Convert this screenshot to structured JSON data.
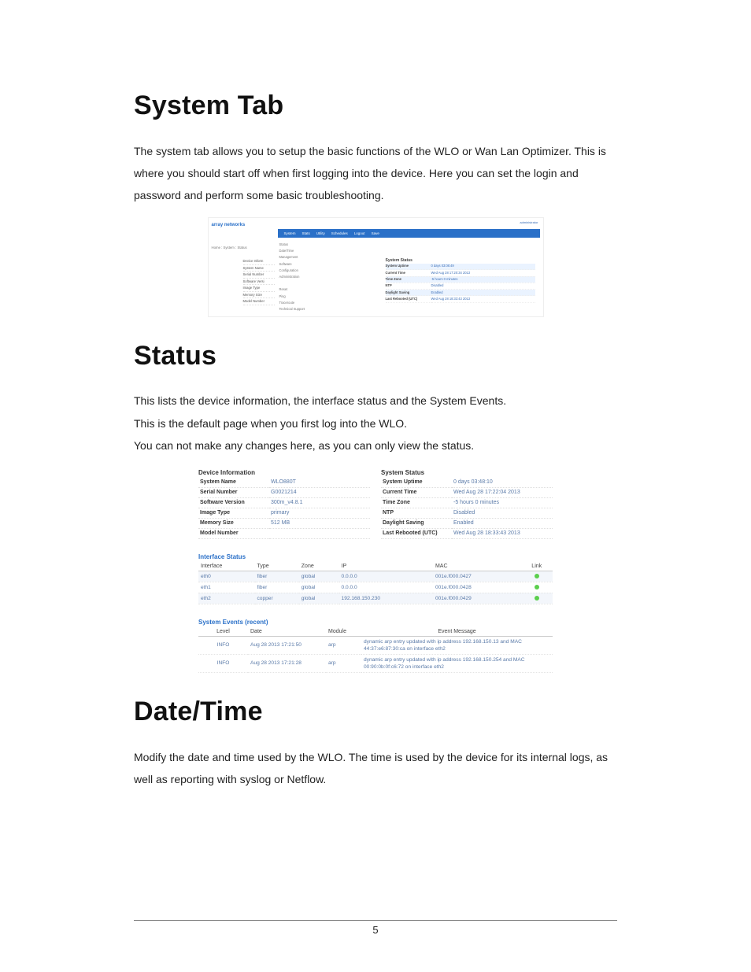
{
  "h1_systemtab": "System Tab",
  "p_systemtab": "The system tab allows you to setup the basic functions of the WLO or Wan Lan Optimizer. This is where you should start off when first logging into the device. Here you can set the login and password and perform some basic troubleshooting.",
  "h1_status": "Status",
  "p_status_1": "This lists the device information, the interface status and the System Events.",
  "p_status_2": "This is the default page when you first log into the WLO.",
  "p_status_3": "You can not make any changes here, as you can only view the status.",
  "h1_datetime": "Date/Time",
  "p_datetime": "Modify the date and time used by the WLO. The time is used by the device for its internal logs, as well as reporting with syslog or Netflow.",
  "page_number": "5",
  "shot1": {
    "logo": "array networks",
    "admin_label": "administrator",
    "topnav": [
      "System",
      "Stats",
      "Utility",
      "Schedules",
      "Logout",
      "Save"
    ],
    "crumb": "Home : System : Status",
    "side_labels": [
      "Device Inform",
      "System Name",
      "Serial Number",
      "Software Versi",
      "Image Type",
      "Memory Size",
      "Model Number"
    ],
    "menu_items": [
      "Status",
      "Date/Time",
      "Management",
      "Software",
      "Configuration",
      "Administration",
      "",
      "Reset",
      "Ping",
      "Traceroute",
      "Technical Support"
    ],
    "panel_title": "System Status",
    "rows": [
      {
        "k": "System Uptime",
        "v": "0 days 03:08:49",
        "hl": true
      },
      {
        "k": "Current Time",
        "v": "Wed Aug 28 17:20:34 2013"
      },
      {
        "k": "Time Zone",
        "v": "-5 hours 0 minutes",
        "hl": true
      },
      {
        "k": "NTP",
        "v": "Disabled"
      },
      {
        "k": "Daylight Saving",
        "v": "Enabled",
        "hl": true
      },
      {
        "k": "Last Rebooted (UTC)",
        "v": "Wed Aug 28 18:33:43 2013"
      }
    ]
  },
  "shot2": {
    "dev_title": "Device Information",
    "dev_rows": [
      {
        "k": "System Name",
        "v": "WLO880T"
      },
      {
        "k": "Serial Number",
        "v": "G0021214"
      },
      {
        "k": "Software Version",
        "v": "300m_v4.8.1"
      },
      {
        "k": "Image Type",
        "v": "primary"
      },
      {
        "k": "Memory Size",
        "v": "512 MB"
      },
      {
        "k": "Model Number",
        "v": ""
      }
    ],
    "sys_title": "System Status",
    "sys_rows": [
      {
        "k": "System Uptime",
        "v": "0 days 03:48:10"
      },
      {
        "k": "Current Time",
        "v": "Wed Aug 28 17:22:04 2013"
      },
      {
        "k": "Time Zone",
        "v": "-5 hours 0 minutes"
      },
      {
        "k": "NTP",
        "v": "Disabled"
      },
      {
        "k": "Daylight Saving",
        "v": "Enabled"
      },
      {
        "k": "Last Rebooted (UTC)",
        "v": "Wed Aug 28 18:33:43 2013"
      }
    ],
    "iface_title": "Interface Status",
    "iface_headers": [
      "Interface",
      "Type",
      "Zone",
      "IP",
      "MAC",
      "Link"
    ],
    "iface_rows": [
      {
        "iface": "eth0",
        "type": "fiber",
        "zone": "global",
        "ip": "0.0.0.0",
        "mac": "001e.f000.0427",
        "link": true,
        "alt": true
      },
      {
        "iface": "eth1",
        "type": "fiber",
        "zone": "global",
        "ip": "0.0.0.0",
        "mac": "001e.f000.0428",
        "link": true,
        "alt": false
      },
      {
        "iface": "eth2",
        "type": "copper",
        "zone": "global",
        "ip": "192.168.150.230",
        "mac": "001e.f000.0429",
        "link": true,
        "alt": true
      }
    ],
    "ev_title": "System Events (recent)",
    "ev_headers": [
      "Level",
      "Date",
      "Module",
      "Event Message"
    ],
    "ev_rows": [
      {
        "level": "INFO",
        "date": "Aug 28 2013 17:21:50",
        "mod": "arp",
        "msg": "dynamic arp entry updated with ip address 192.168.150.13 and MAC 44:37:e6:87:30:ca on interface eth2"
      },
      {
        "level": "INFO",
        "date": "Aug 28 2013 17:21:28",
        "mod": "arp",
        "msg": "dynamic arp entry updated with ip address 192.168.150.254 and MAC 00:90:0b:0f:c6:72 on interface eth2"
      }
    ]
  }
}
